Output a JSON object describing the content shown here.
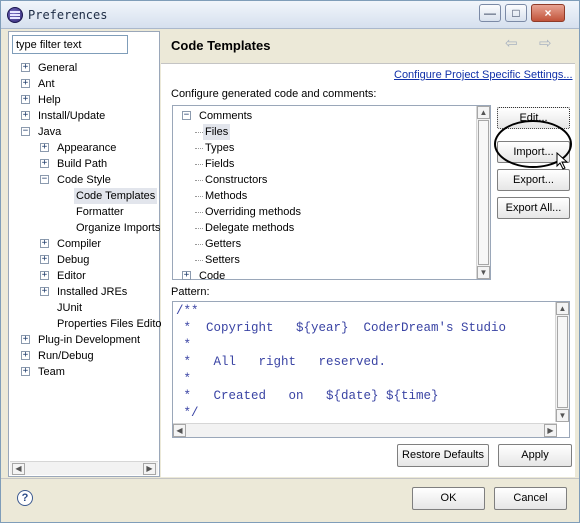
{
  "window": {
    "title": "Preferences",
    "controls": {
      "minimize": "—",
      "maximize": "□",
      "close": "×"
    }
  },
  "left": {
    "filter_placeholder": "type filter text",
    "tree": [
      {
        "label": "General",
        "level": 0,
        "expander": "+"
      },
      {
        "label": "Ant",
        "level": 0,
        "expander": "+"
      },
      {
        "label": "Help",
        "level": 0,
        "expander": "+"
      },
      {
        "label": "Install/Update",
        "level": 0,
        "expander": "+"
      },
      {
        "label": "Java",
        "level": 0,
        "expander": "−"
      },
      {
        "label": "Appearance",
        "level": 1,
        "expander": "+"
      },
      {
        "label": "Build Path",
        "level": 1,
        "expander": "+"
      },
      {
        "label": "Code Style",
        "level": 1,
        "expander": "−"
      },
      {
        "label": "Code Templates",
        "level": 2,
        "expander": "",
        "selected": true
      },
      {
        "label": "Formatter",
        "level": 2,
        "expander": ""
      },
      {
        "label": "Organize Imports",
        "level": 2,
        "expander": ""
      },
      {
        "label": "Compiler",
        "level": 1,
        "expander": "+"
      },
      {
        "label": "Debug",
        "level": 1,
        "expander": "+"
      },
      {
        "label": "Editor",
        "level": 1,
        "expander": "+"
      },
      {
        "label": "Installed JREs",
        "level": 1,
        "expander": "+"
      },
      {
        "label": "JUnit",
        "level": 1,
        "expander": ""
      },
      {
        "label": "Properties Files Edito",
        "level": 1,
        "expander": ""
      },
      {
        "label": "Plug-in Development",
        "level": 0,
        "expander": "+"
      },
      {
        "label": "Run/Debug",
        "level": 0,
        "expander": "+"
      },
      {
        "label": "Team",
        "level": 0,
        "expander": "+"
      }
    ]
  },
  "right": {
    "title": "Code Templates",
    "back_arrow": "⇦",
    "forward_arrow": "⇨",
    "project_link": "Configure Project Specific Settings...",
    "description": "Configure generated code and comments:",
    "templates": [
      {
        "label": "Comments",
        "level": 0,
        "expander": "−"
      },
      {
        "label": "Files",
        "level": 1,
        "selected": true
      },
      {
        "label": "Types",
        "level": 1
      },
      {
        "label": "Fields",
        "level": 1
      },
      {
        "label": "Constructors",
        "level": 1
      },
      {
        "label": "Methods",
        "level": 1
      },
      {
        "label": "Overriding methods",
        "level": 1
      },
      {
        "label": "Delegate methods",
        "level": 1
      },
      {
        "label": "Getters",
        "level": 1
      },
      {
        "label": "Setters",
        "level": 1
      },
      {
        "label": "Code",
        "level": 0,
        "expander": "+"
      }
    ],
    "buttons": {
      "edit": "Edit...",
      "import": "Import...",
      "export": "Export...",
      "export_all": "Export All..."
    },
    "pattern_label": "Pattern:",
    "pattern_lines": [
      "/**",
      " *  Copyright   ${year}  CoderDream's Studio",
      " *",
      " *   All   right   reserved.",
      " *",
      " *   Created   on   ${date} ${time}",
      " */"
    ],
    "restore_defaults": "Restore Defaults",
    "apply": "Apply"
  },
  "footer": {
    "help_icon": "?",
    "ok": "OK",
    "cancel": "Cancel"
  }
}
